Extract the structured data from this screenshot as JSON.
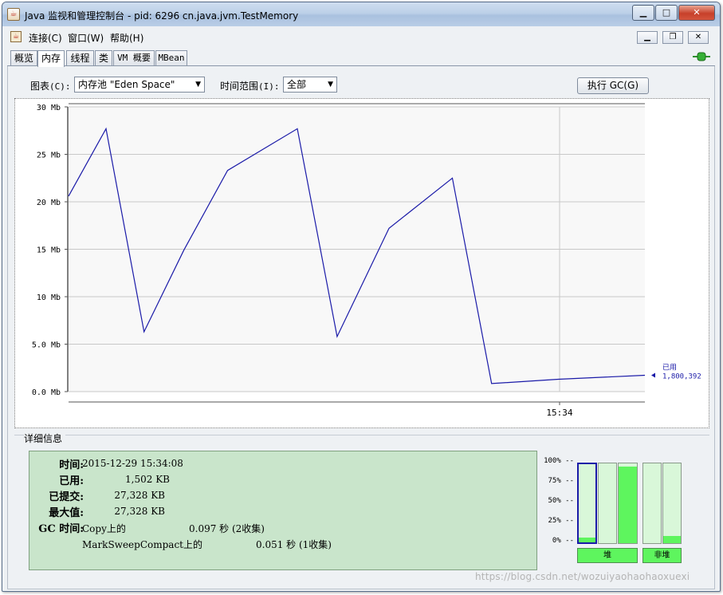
{
  "window": {
    "title": "Java 监视和管理控制台 - pid: 6296 cn.java.jvm.TestMemory",
    "minimize_glyph": "▁",
    "maximize_glyph": "□",
    "close_glyph": "✕"
  },
  "menubar": {
    "items": [
      "连接(C)",
      "窗口(W)",
      "帮助(H)"
    ],
    "mdi_minimize": "▁",
    "mdi_restore": "❐",
    "mdi_close": "✕"
  },
  "tabs": [
    "概览",
    "内存",
    "线程",
    "类",
    "VM 概要",
    "MBean"
  ],
  "active_tab": "内存",
  "controls": {
    "chart_label": "图表",
    "chart_mnemonic": "(C):",
    "chart_value": "内存池 \"Eden Space\"",
    "range_label": "时间范围",
    "range_mnemonic": "(I):",
    "range_value": "全部",
    "gc_button": "执行 GC(G)"
  },
  "chart_data": {
    "type": "line",
    "yunit": "Mb",
    "ylim": [
      0,
      30
    ],
    "yticks": [
      "0.0 Mb",
      "5.0 Mb",
      "10 Mb",
      "15 Mb",
      "20 Mb",
      "25 Mb",
      "30 Mb"
    ],
    "ytick_values": [
      0,
      5,
      10,
      15,
      20,
      25,
      30
    ],
    "xtick": "15:34",
    "xtick_position": 0.852,
    "series": [
      {
        "name": "已用",
        "color": "#1a1aa8",
        "x": [
          0,
          0.065,
          0.131,
          0.2,
          0.276,
          0.397,
          0.466,
          0.556,
          0.666,
          0.734,
          0.85,
          1.0
        ],
        "values": [
          20.6,
          27.7,
          6.3,
          14.9,
          23.3,
          27.7,
          5.8,
          17.2,
          22.5,
          0.85,
          1.3,
          1.72
        ]
      }
    ],
    "current_label": "已用",
    "current_value": "1,800,392",
    "grid": true
  },
  "details": {
    "title": "详细信息",
    "time_label": "时间:",
    "time_value": "2015-12-29 15:34:08",
    "used_label": "已用:",
    "used_value": "1,502 KB",
    "committed_label": "已提交:",
    "committed_value": "27,328 KB",
    "max_label": "最大值:",
    "max_value": "27,328 KB",
    "gc_label": "GC 时间:",
    "gc1_name": "Copy上的",
    "gc1_value": "0.097 秒 (2收集)",
    "gc2_name": "MarkSweepCompact上的",
    "gc2_value": "0.051 秒 (1收集)"
  },
  "pool_bars": {
    "ticks": [
      "100% --",
      "75% --",
      "50% --",
      "25% --",
      "0% --"
    ],
    "levels": [
      0.06,
      0.0,
      0.96,
      0.0,
      0.09
    ],
    "heap_label": "堆",
    "nonheap_label": "非堆"
  },
  "watermark": "https://blog.csdn.net/wozuiyaohaohaoxuexi"
}
